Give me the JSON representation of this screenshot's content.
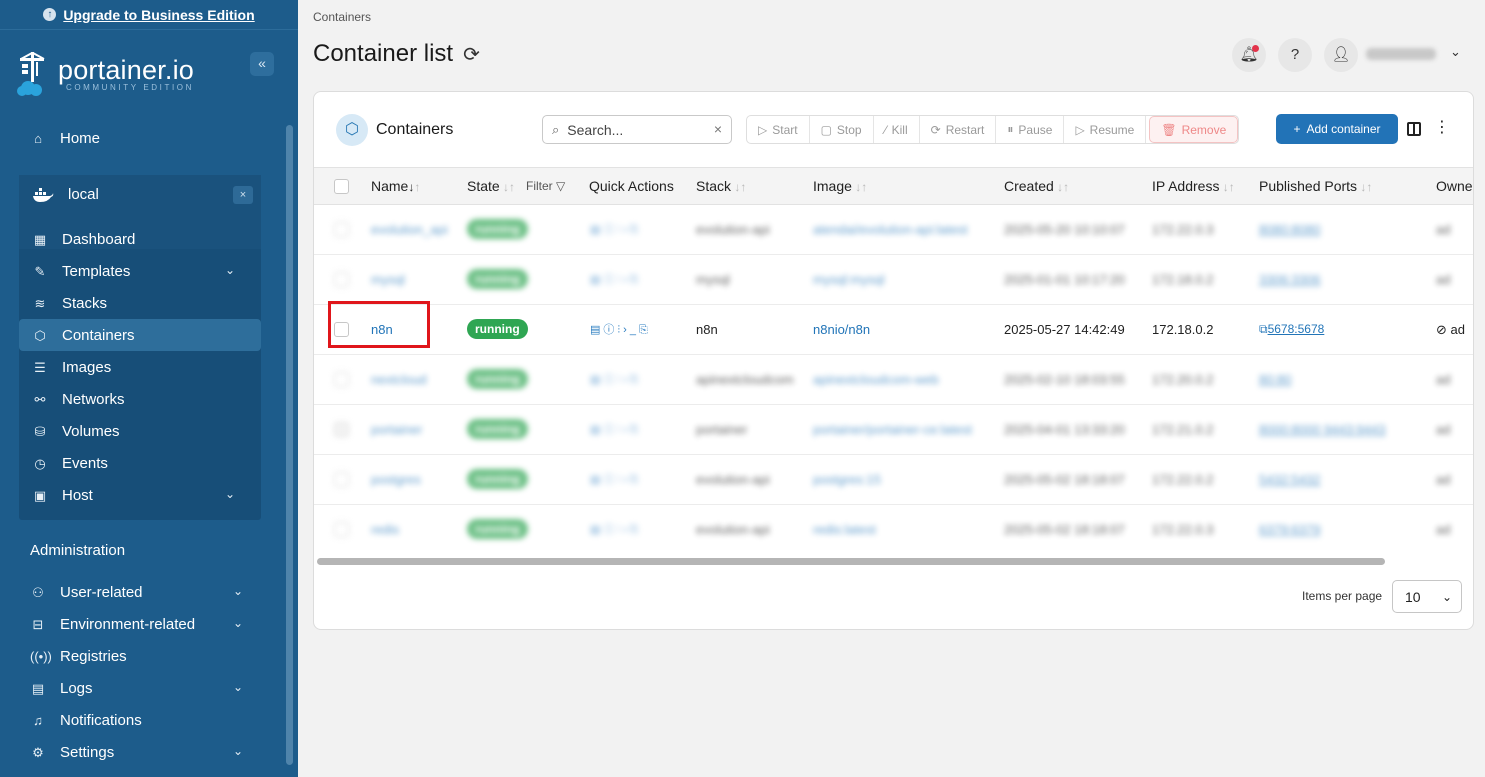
{
  "sidebar": {
    "upgrade_label": "Upgrade to Business Edition",
    "logo_main": "portainer.io",
    "logo_sub": "COMMUNITY EDITION",
    "collapse_icon": "«",
    "home": "Home",
    "environment": {
      "name": "local",
      "close": "×"
    },
    "env_items": [
      {
        "label": "Dashboard",
        "icon": "dashboard-icon"
      },
      {
        "label": "Templates",
        "icon": "edit-icon"
      },
      {
        "label": "Stacks",
        "icon": "layers-icon"
      },
      {
        "label": "Containers",
        "icon": "box-icon"
      },
      {
        "label": "Images",
        "icon": "list-icon"
      },
      {
        "label": "Networks",
        "icon": "network-icon"
      },
      {
        "label": "Volumes",
        "icon": "database-icon"
      },
      {
        "label": "Events",
        "icon": "clock-icon"
      },
      {
        "label": "Host",
        "icon": "server-icon"
      }
    ],
    "administration_title": "Administration",
    "admin_items": [
      {
        "label": "User-related",
        "icon": "users-icon"
      },
      {
        "label": "Environment-related",
        "icon": "hdd-icon"
      },
      {
        "label": "Registries",
        "icon": "radio-icon"
      },
      {
        "label": "Logs",
        "icon": "file-icon"
      },
      {
        "label": "Notifications",
        "icon": "bell-icon"
      },
      {
        "label": "Settings",
        "icon": "gear-icon"
      }
    ]
  },
  "header": {
    "breadcrumb": "Containers",
    "title": "Container list"
  },
  "card": {
    "title": "Containers",
    "search_placeholder": "Search...",
    "actions": {
      "start": "Start",
      "stop": "Stop",
      "kill": "Kill",
      "restart": "Restart",
      "pause": "Pause",
      "resume": "Resume",
      "remove": "Remove"
    },
    "add_label": "Add container",
    "columns": {
      "name": "Name",
      "state": "State",
      "filter": "Filter",
      "quick_actions": "Quick Actions",
      "stack": "Stack",
      "image": "Image",
      "created": "Created",
      "ip": "IP Address",
      "ports": "Published Ports",
      "owner": "Owne"
    },
    "rows": [
      {
        "name": "evolution_api",
        "state": "running",
        "stack": "evolution-api",
        "image": "atendai/evolution-api:latest",
        "created": "2025-05-20 10:10:07",
        "ip": "172.22.0.3",
        "ports": "8080:8080",
        "owner": "ad"
      },
      {
        "name": "mysql",
        "state": "running",
        "stack": "mysql",
        "image": "mysql:mysql",
        "created": "2025-01-01 10:17:20",
        "ip": "172.18.0.2",
        "ports": "3306:3306",
        "owner": "ad"
      },
      {
        "name": "n8n",
        "state": "running",
        "stack": "n8n",
        "image": "n8nio/n8n",
        "created": "2025-05-27 14:42:49",
        "ip": "172.18.0.2",
        "ports": "5678:5678",
        "owner": "ad"
      },
      {
        "name": "nextcloud",
        "state": "running",
        "stack": "apinextcloudcom",
        "image": "apinextcloudcom-web",
        "created": "2025-02-10 18:03:55",
        "ip": "172.20.0.2",
        "ports": "80:80",
        "owner": "ad"
      },
      {
        "name": "portainer",
        "state": "running",
        "stack": "portainer",
        "image": "portainer/portainer-ce:latest",
        "created": "2025-04-01 13:33:20",
        "ip": "172.21.0.2",
        "ports": "8000:8000 9443:9443",
        "owner": "ad"
      },
      {
        "name": "postgres",
        "state": "running",
        "stack": "evolution-api",
        "image": "postgres:15",
        "created": "2025-05-02 18:18:07",
        "ip": "172.22.0.2",
        "ports": "5432:5432",
        "owner": "ad"
      },
      {
        "name": "redis",
        "state": "running",
        "stack": "evolution-api",
        "image": "redis:latest",
        "created": "2025-05-02 18:18:07",
        "ip": "172.22.0.3",
        "ports": "6379:6379",
        "owner": "ad"
      }
    ],
    "items_per_page_label": "Items per page",
    "items_per_page_value": "10"
  }
}
